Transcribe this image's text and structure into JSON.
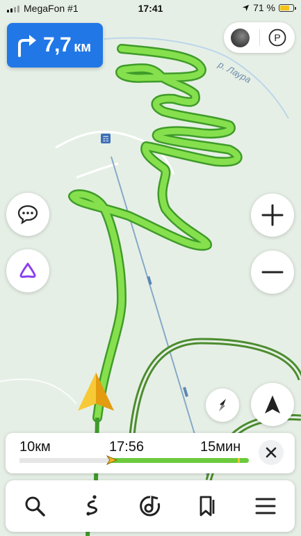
{
  "status_bar": {
    "carrier": "MegaFon #1",
    "time": "17:41",
    "battery": "71 %",
    "battery_level": 0.71
  },
  "maneuver": {
    "direction_icon": "turn-right-arrow-icon",
    "distance": "7,7",
    "unit": "км"
  },
  "map": {
    "river_label": "р. Лаура",
    "road_sign": "☶"
  },
  "top_controls": {
    "traffic_icon": "traffic-layer-icon",
    "parking_label": "P"
  },
  "side_controls": {
    "chat_icon": "speech-bubble-icon",
    "assistant_icon": "alice-assistant-icon",
    "zoom_in_label": "+",
    "zoom_out_label": "−",
    "compass_icon": "compass-icon",
    "locate_icon": "navigation-arrow-icon"
  },
  "trip": {
    "distance": "10км",
    "arrival": "17:56",
    "duration": "15мин",
    "progress": 0.4,
    "close_icon": "close-icon"
  },
  "bottom_nav": [
    {
      "icon": "search-icon"
    },
    {
      "icon": "route-icon"
    },
    {
      "icon": "music-icon"
    },
    {
      "icon": "bookmarks-icon"
    },
    {
      "icon": "menu-icon"
    }
  ],
  "colors": {
    "accent_blue": "#2177e6",
    "route_green": "#6ccb3d",
    "route_dark_green": "#4c8c2e",
    "map_bg": "#e6efe6",
    "assistant_purple": "#8a3ff0",
    "cursor_yellow": "#f2b51d"
  }
}
